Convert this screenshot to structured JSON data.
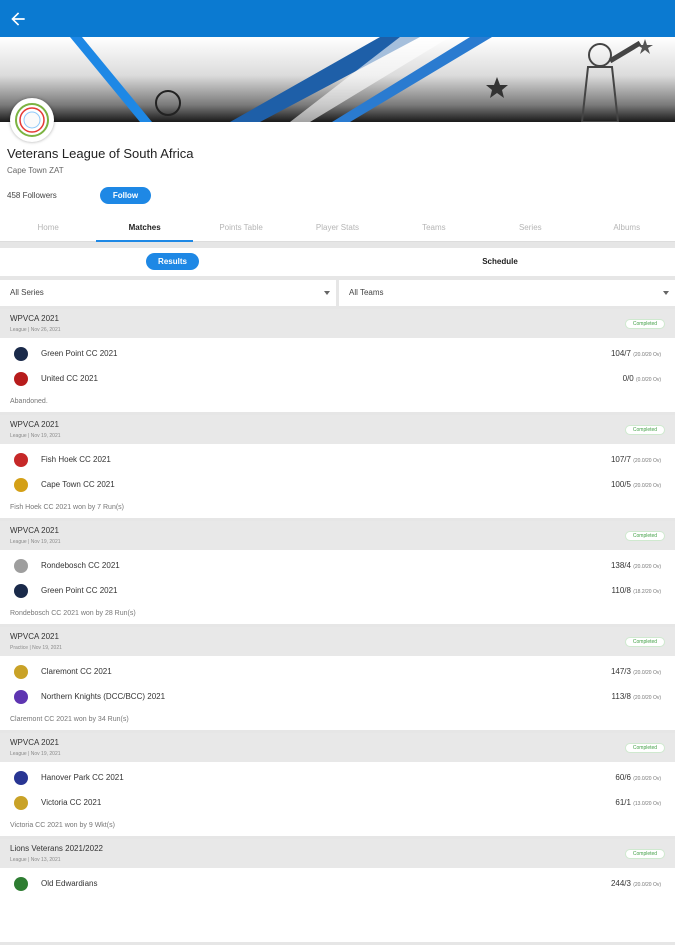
{
  "appbar": {
    "back_icon": "arrow-left-icon",
    "color": "#0b7ad1"
  },
  "profile": {
    "name": "Veterans League of South Africa",
    "location": "Cape Town ZAT",
    "followers": "458 Followers",
    "follow_label": "Follow"
  },
  "tabs": [
    {
      "label": "Home",
      "active": false
    },
    {
      "label": "Matches",
      "active": true
    },
    {
      "label": "Points Table",
      "active": false
    },
    {
      "label": "Player Stats",
      "active": false
    },
    {
      "label": "Teams",
      "active": false
    },
    {
      "label": "Series",
      "active": false
    },
    {
      "label": "Albums",
      "active": false
    }
  ],
  "subtabs": {
    "results": "Results",
    "schedule": "Schedule"
  },
  "filters": {
    "series": "All Series",
    "teams": "All Teams"
  },
  "matches": [
    {
      "series": "WPVCA 2021",
      "meta": "League | Nov 26, 2021",
      "status": "Completed",
      "teams": [
        {
          "name": "Green Point CC 2021",
          "score": "104/7",
          "overs": "(20.0/20 Ov)",
          "icon_color": "#1a2a4a"
        },
        {
          "name": "United CC 2021",
          "score": "0/0",
          "overs": "(0.0/20 Ov)",
          "icon_color": "#b71c1c"
        }
      ],
      "result": "Abandoned."
    },
    {
      "series": "WPVCA 2021",
      "meta": "League | Nov 19, 2021",
      "status": "Completed",
      "teams": [
        {
          "name": "Fish Hoek CC 2021",
          "score": "107/7",
          "overs": "(20.0/20 Ov)",
          "icon_color": "#c62828"
        },
        {
          "name": "Cape Town CC 2021",
          "score": "100/5",
          "overs": "(20.0/20 Ov)",
          "icon_color": "#d4a017"
        }
      ],
      "result": "Fish Hoek CC 2021 won by 7 Run(s)"
    },
    {
      "series": "WPVCA 2021",
      "meta": "League | Nov 19, 2021",
      "status": "Completed",
      "teams": [
        {
          "name": "Rondebosch CC 2021",
          "score": "138/4",
          "overs": "(20.0/20 Ov)",
          "icon_color": "#9e9e9e"
        },
        {
          "name": "Green Point CC 2021",
          "score": "110/8",
          "overs": "(18.2/20 Ov)",
          "icon_color": "#1a2a4a"
        }
      ],
      "result": "Rondebosch CC 2021 won by 28 Run(s)"
    },
    {
      "series": "WPVCA 2021",
      "meta": "Practice | Nov 19, 2021",
      "status": "Completed",
      "teams": [
        {
          "name": "Claremont CC 2021",
          "score": "147/3",
          "overs": "(20.0/20 Ov)",
          "icon_color": "#c9a227"
        },
        {
          "name": "Northern Knights (DCC/BCC) 2021",
          "score": "113/8",
          "overs": "(20.0/20 Ov)",
          "icon_color": "#5e35b1"
        }
      ],
      "result": "Claremont CC 2021 won by 34 Run(s)"
    },
    {
      "series": "WPVCA 2021",
      "meta": "League | Nov 19, 2021",
      "status": "Completed",
      "teams": [
        {
          "name": "Hanover Park CC 2021",
          "score": "60/6",
          "overs": "(20.0/20 Ov)",
          "icon_color": "#283593"
        },
        {
          "name": "Victoria CC 2021",
          "score": "61/1",
          "overs": "(13.0/20 Ov)",
          "icon_color": "#c9a227"
        }
      ],
      "result": "Victoria CC 2021 won by 9 Wkt(s)"
    },
    {
      "series": "Lions Veterans 2021/2022",
      "meta": "League | Nov 13, 2021",
      "status": "Completed",
      "teams": [
        {
          "name": "Old Edwardians",
          "score": "244/3",
          "overs": "(20.0/20 Ov)",
          "icon_color": "#2e7d32"
        }
      ],
      "result": ""
    }
  ]
}
